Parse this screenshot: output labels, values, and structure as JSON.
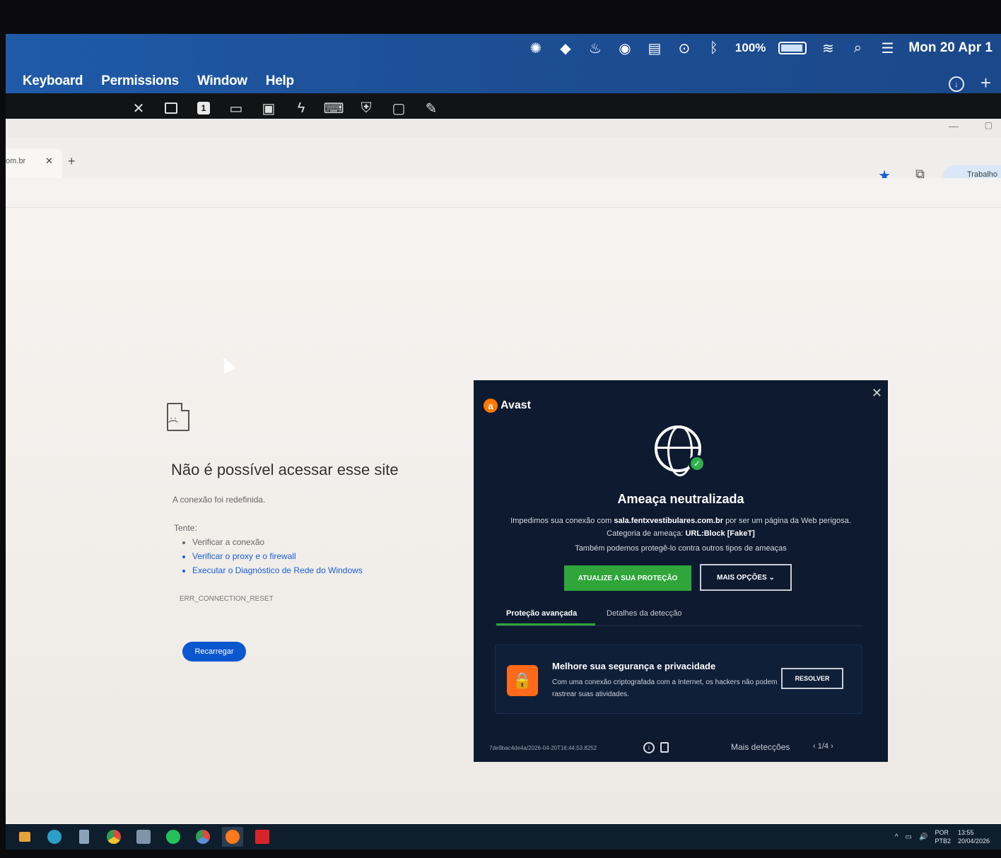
{
  "mac_menu": {
    "items": [
      "Keyboard",
      "Permissions",
      "Window",
      "Help"
    ],
    "battery_text": "100%",
    "date": "Mon 20 Apr 1"
  },
  "browser": {
    "tab_title": "om.br",
    "profile_label": "Trabalho"
  },
  "error_page": {
    "title": "Não é possível acessar esse site",
    "subtitle": "A conexão foi redefinida.",
    "try_label": "Tente:",
    "suggestions": [
      "Verificar a conexão",
      "Verificar o proxy e o firewall",
      "Executar o Diagnóstico de Rede do Windows"
    ],
    "error_code": "ERR_CONNECTION_RESET",
    "reload_label": "Recarregar"
  },
  "avast": {
    "brand": "Avast",
    "title": "Ameaça neutralizada",
    "desc_prefix": "Impedimos sua conexão com ",
    "desc_domain": "sala.fentxvestibulares.com.br",
    "desc_mid": " por ser um página da Web perigosa. Categoria de ameaça: ",
    "desc_category": "URL:Block [FakeT]",
    "also": "Também podemos protegê-lo contra outros tipos de ameaças",
    "update_button": "ATUALIZE A SUA PROTEÇÃO",
    "more_button": "MAIS OPÇÕES",
    "tab_active": "Proteção avançada",
    "tab_second": "Detalhes da detecção",
    "card_title": "Melhore sua segurança e privacidade",
    "card_text": "Com uma conexão criptografada com a Internet, os hackers não podem rastrear suas atividades.",
    "resolve_button": "RESOLVER",
    "detection_id": "7de9bac4de4a/2026-04-20T16:44:53.8252",
    "more_detections": "Mais detecções",
    "pager": "1/4"
  },
  "taskbar": {
    "lang_top": "POR",
    "lang_bottom": "PTB2",
    "time": "13:55",
    "date": "20/04/2026"
  },
  "colors": {
    "mac_bar": "#1f5aa8",
    "avast_bg": "#0d1a30",
    "avast_green": "#2fa53a",
    "avast_orange": "#ff6a1a",
    "chrome_blue": "#0b57d0"
  }
}
